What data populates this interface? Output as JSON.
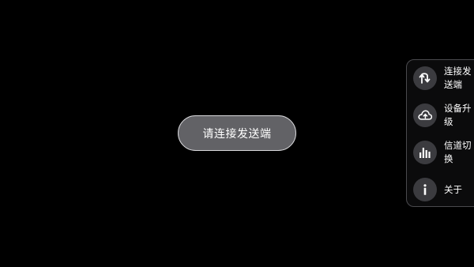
{
  "connect_prompt": "请连接发送端",
  "menu": {
    "items": [
      {
        "icon": "connection-icon",
        "label": "连接发送端"
      },
      {
        "icon": "cloud-upload-icon",
        "label": "设备升级"
      },
      {
        "icon": "signal-bars-icon",
        "label": "信道切换"
      },
      {
        "icon": "info-icon",
        "label": "关于"
      }
    ]
  },
  "colors": {
    "background": "#000000",
    "pill_fill": "#626266",
    "pill_border": "#d9d9dc",
    "panel_border": "#4a4a4e",
    "icon_circle": "#3b3b3f",
    "text": "#ffffff"
  }
}
